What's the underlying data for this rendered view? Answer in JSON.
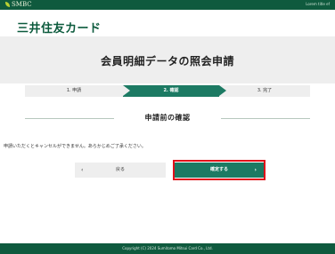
{
  "topbar": {
    "brand": "SMBC",
    "right_text": "Lorem title ef"
  },
  "header": {
    "logo": "三井住友カード"
  },
  "page": {
    "title": "会員明細データの照会申請"
  },
  "steps": [
    {
      "label": "1. 申請"
    },
    {
      "label": "2. 確認"
    },
    {
      "label": "3. 完了"
    }
  ],
  "section": {
    "title": "申請前の確認"
  },
  "notice": "申請いただくとキャンセルができません。あらかじめご了承ください。",
  "buttons": {
    "back": "戻る",
    "back_chevron": "‹",
    "confirm": "確定する",
    "confirm_chevron": "›"
  },
  "footer": {
    "copyright": "Copyright (C) 2024 Sumitomo Mitsui Card Co., Ltd."
  },
  "colors": {
    "brand_green": "#0f5a3e",
    "accent_green": "#1c7a63",
    "highlight_red": "#e0101a"
  }
}
